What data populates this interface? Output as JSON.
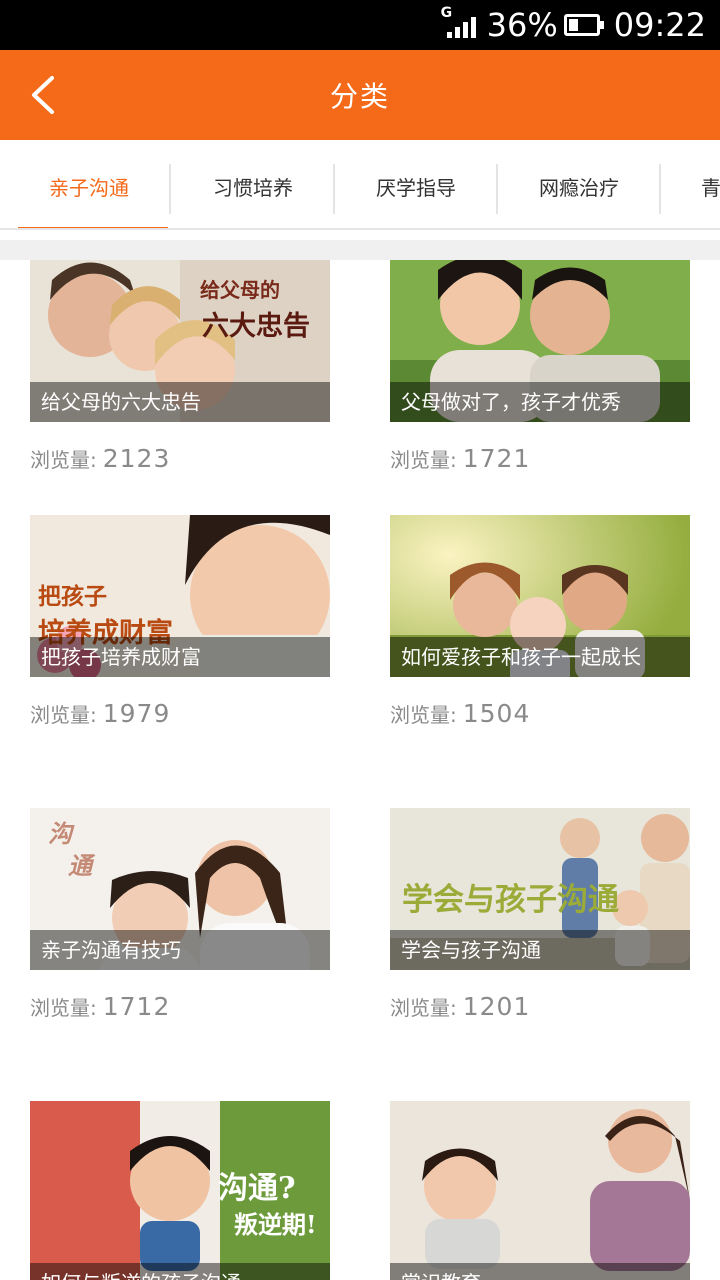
{
  "status_bar": {
    "network": "G",
    "battery_percent": "36%",
    "battery_level": 0.36,
    "time": "09:22"
  },
  "header": {
    "title": "分类",
    "back_icon": "chevron-left-icon"
  },
  "tabs": [
    {
      "label": "亲子沟通",
      "active": true
    },
    {
      "label": "习惯培养",
      "active": false
    },
    {
      "label": "厌学指导",
      "active": false
    },
    {
      "label": "网瘾治疗",
      "active": false
    },
    {
      "label": "青",
      "active": false
    }
  ],
  "views_label": "浏览量:",
  "articles": [
    {
      "caption": "给父母的六大忠告",
      "views": "2123",
      "overlay": [
        "给父母的",
        "六大忠告"
      ],
      "colors": [
        "#e9e2d7",
        "#b88f78"
      ]
    },
    {
      "caption": "父母做对了，孩子才优秀",
      "views": "1721",
      "overlay": [],
      "colors": [
        "#7fae4a",
        "#3f6a25"
      ]
    },
    {
      "caption": "把孩子培养成财富",
      "views": "1979",
      "overlay": [
        "把孩子",
        "培养成财富"
      ],
      "colors": [
        "#f1e9de",
        "#d9c3aa"
      ]
    },
    {
      "caption": "如何爱孩子和孩子一起成长",
      "views": "1504",
      "overlay": [],
      "colors": [
        "#d8c25e",
        "#8aa642"
      ]
    },
    {
      "caption": "亲子沟通有技巧",
      "views": "1712",
      "overlay": [
        "沟",
        "通"
      ],
      "colors": [
        "#f4f1ec",
        "#e0d6c8"
      ]
    },
    {
      "caption": "学会与孩子沟通",
      "views": "1201",
      "overlay": [
        "学会与孩子沟通"
      ],
      "colors": [
        "#e8e6da",
        "#a9a58e"
      ]
    },
    {
      "caption": "如何与叛逆的孩子沟通",
      "views": "",
      "overlay": [
        "沟通?",
        "叛逆期!"
      ],
      "colors": [
        "#d95b4c",
        "#6d9b3c"
      ]
    },
    {
      "caption": "赏识教育",
      "views": "",
      "overlay": [],
      "colors": [
        "#ece5dc",
        "#c3a18f"
      ]
    }
  ]
}
